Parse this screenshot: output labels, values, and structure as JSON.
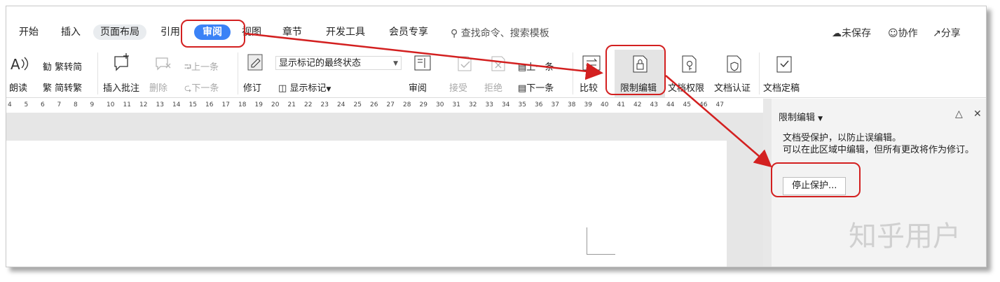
{
  "menu": {
    "tabs": [
      "开始",
      "插入",
      "页面布局",
      "引用",
      "审阅",
      "视图",
      "章节",
      "开发工具",
      "会员专享"
    ],
    "search_placeholder": "查找命令、搜索模板",
    "right_actions": [
      "未保存",
      "协作",
      "分享"
    ]
  },
  "ribbon": {
    "read_aloud": "朗读",
    "trad_simp": [
      "繁转简",
      "简转繁"
    ],
    "insert_comment": "插入批注",
    "delete": "删除",
    "prev_comment": "上一条",
    "next_comment": "下一条",
    "revise": "修订",
    "display_select": "显示标记的最终状态",
    "show_markup": "显示标记",
    "review": "审阅",
    "accept": "接受",
    "reject": "拒绝",
    "prev_change": "上一条",
    "next_change": "下一条",
    "compare": "比较",
    "restrict_edit": "限制编辑",
    "doc_permissions": "文档权限",
    "doc_cert": "文档认证",
    "doc_finalize": "文档定稿"
  },
  "ruler": [
    "4",
    "5",
    "6",
    "7",
    "8",
    "9",
    "10",
    "11",
    "12",
    "13",
    "14",
    "15",
    "16",
    "17",
    "18",
    "19",
    "20",
    "21",
    "22",
    "23",
    "24",
    "25",
    "26",
    "27",
    "28",
    "29",
    "30",
    "31",
    "32",
    "33",
    "34",
    "35",
    "36",
    "37",
    "38",
    "39",
    "40",
    "41",
    "42",
    "43",
    "44",
    "45",
    "46",
    "47"
  ],
  "pane": {
    "title": "限制编辑",
    "line1": "文档受保护，以防止误编辑。",
    "line2": "可以在此区域中编辑，但所有更改将作为修订。",
    "stop_button": "停止保护..."
  },
  "watermark": "知乎用户",
  "colors": {
    "accent": "#3b82f6",
    "annotation": "#d32020"
  }
}
